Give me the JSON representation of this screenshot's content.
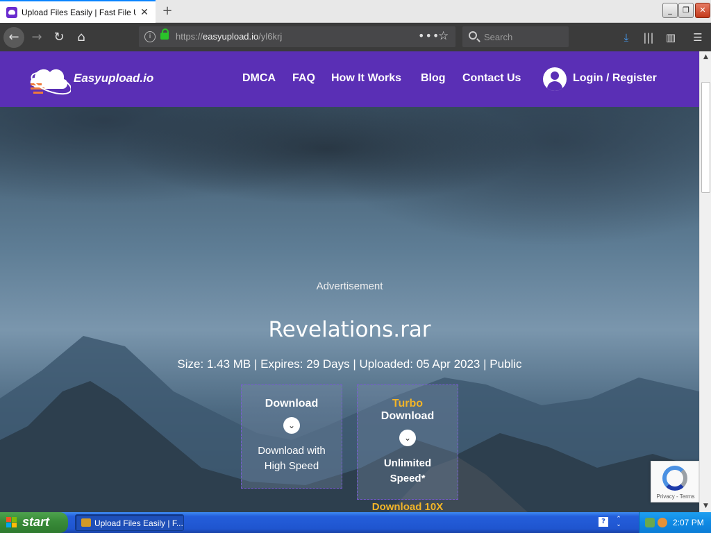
{
  "browser": {
    "tab_title": "Upload Files Easily | Fast File Uplo",
    "url_prefix": "https://",
    "url_domain": "easyupload.io",
    "url_path": "/yl6krj",
    "search_placeholder": "Search"
  },
  "site": {
    "logo_text": "Easyupload.io",
    "nav": [
      "DMCA",
      "FAQ",
      "How It Works",
      "Blog",
      "Contact Us"
    ],
    "login_label": "Login / Register"
  },
  "content": {
    "advertisement": "Advertisement",
    "file_name": "Revelations.rar",
    "file_info": "Size: 1.43 MB | Expires: 29 Days | Uploaded: 05 Apr 2023 | Public",
    "download_normal": {
      "title": "Download",
      "desc_line1": "Download with",
      "desc_line2": "High Speed"
    },
    "download_turbo": {
      "title_accent": "Turbo",
      "title": "Download",
      "desc_line1": "Unlimited",
      "desc_line2": "Speed*"
    },
    "download_10x": "Download 10X"
  },
  "recaptcha": {
    "links": "Privacy - Terms"
  },
  "taskbar": {
    "start_label": "start",
    "task_item": "Upload Files Easily | F...",
    "clock": "2:07 PM"
  },
  "colors": {
    "header_purple": "#5a2fb5",
    "turbo_gold": "#f2b428",
    "tab_accent": "#0a84ff"
  }
}
